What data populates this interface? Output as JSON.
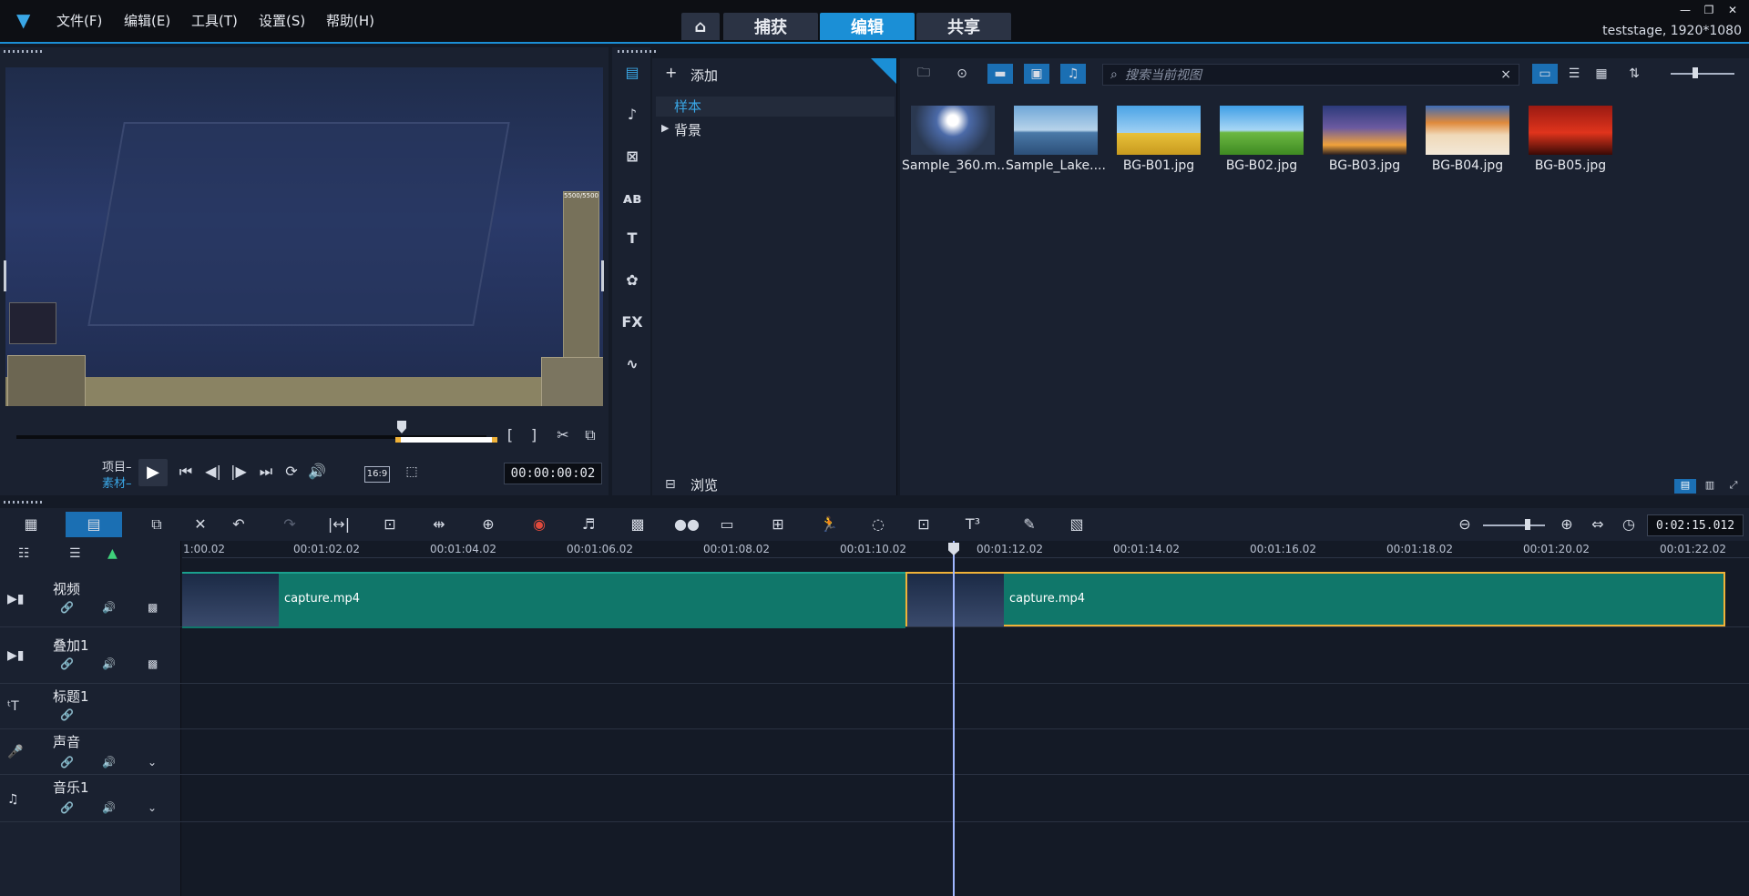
{
  "app": {
    "menu": [
      "文件(F)",
      "编辑(E)",
      "工具(T)",
      "设置(S)",
      "帮助(H)"
    ],
    "nav_tabs": [
      {
        "label": "捕获",
        "active": false
      },
      {
        "label": "编辑",
        "active": true
      },
      {
        "label": "共享",
        "active": false
      }
    ],
    "stage_info": "teststage, 1920*1080",
    "accent_color": "#1b8fd6"
  },
  "preview": {
    "mode_project": "项目–",
    "mode_clip": "素材–",
    "aspect": "16:9",
    "timecode": "00:00:00:02",
    "hud_text": "5500/5500"
  },
  "library": {
    "add_label": "添加",
    "folders": [
      {
        "label": "样本",
        "selected": true
      },
      {
        "label": "背景",
        "selected": false
      }
    ],
    "browse_label": "浏览",
    "search_placeholder": "搜索当前视图",
    "items": [
      {
        "caption": "Sample_360.m...",
        "thumb": "sample360"
      },
      {
        "caption": "Sample_Lake....",
        "thumb": "lake"
      },
      {
        "caption": "BG-B01.jpg",
        "thumb": "tree-yellow"
      },
      {
        "caption": "BG-B02.jpg",
        "thumb": "tree-green"
      },
      {
        "caption": "BG-B03.jpg",
        "thumb": "sunset"
      },
      {
        "caption": "BG-B04.jpg",
        "thumb": "desert"
      },
      {
        "caption": "BG-B05.jpg",
        "thumb": "red-sky"
      }
    ]
  },
  "timeline": {
    "timecode": "0:02:15.012",
    "ruler_ticks": [
      "1:00.02",
      "00:01:02.02",
      "00:01:04.02",
      "00:01:06.02",
      "00:01:08.02",
      "00:01:10.02",
      "00:01:12.02",
      "00:01:14.02",
      "00:01:16.02",
      "00:01:18.02",
      "00:01:20.02",
      "00:01:22.02"
    ],
    "tracks": [
      {
        "name": "视频",
        "icon": "video-icon"
      },
      {
        "name": "叠加1",
        "icon": "overlay-icon"
      },
      {
        "name": "标题1",
        "icon": "title-icon"
      },
      {
        "name": "声音",
        "icon": "voice-icon"
      },
      {
        "name": "音乐1",
        "icon": "music-icon"
      }
    ],
    "clips": [
      {
        "label": "capture.mp4"
      },
      {
        "label": "capture.mp4"
      }
    ],
    "clip_color": "#10776a"
  }
}
